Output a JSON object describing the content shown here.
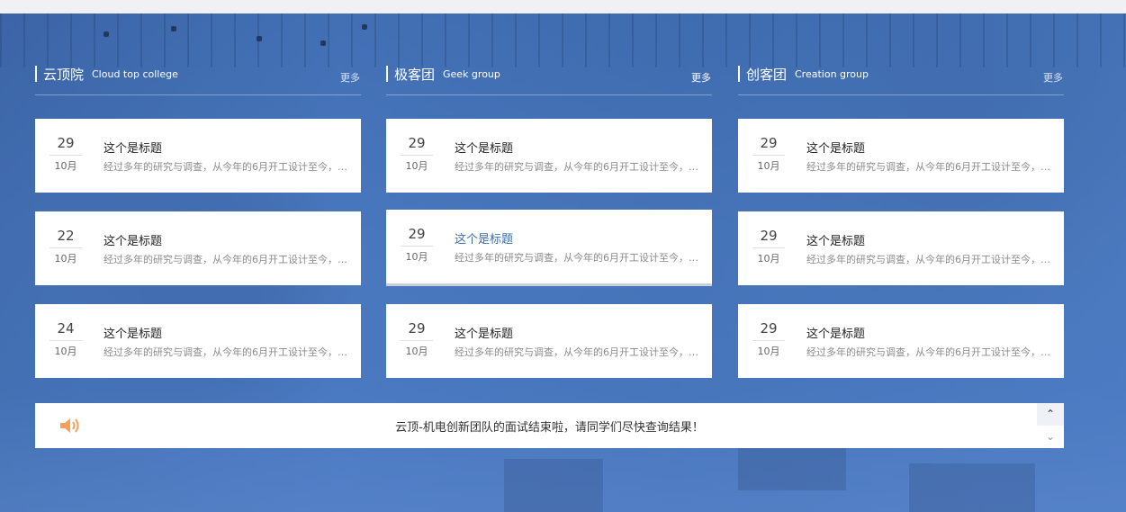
{
  "columns": [
    {
      "title_cn": "云顶院",
      "title_en": "Cloud top college",
      "more": "更多",
      "cards": [
        {
          "day": "29",
          "month": "10月",
          "title": "这个是标题",
          "desc": "经过多年的研究与调查，从今年的6月开工设计至今，已经三月有余"
        },
        {
          "day": "22",
          "month": "10月",
          "title": "这个是标题",
          "desc": "经过多年的研究与调查，从今年的6月开工设计至今，已经三月有余"
        },
        {
          "day": "24",
          "month": "10月",
          "title": "这个是标题",
          "desc": "经过多年的研究与调查，从今年的6月开工设计至今，已经三月有余"
        }
      ]
    },
    {
      "title_cn": "极客团",
      "title_en": "Geek group",
      "more": "更多",
      "cards": [
        {
          "day": "29",
          "month": "10月",
          "title": "这个是标题",
          "desc": "经过多年的研究与调查，从今年的6月开工设计至今，已经三月有余"
        },
        {
          "day": "29",
          "month": "10月",
          "title": "这个是标题",
          "desc": "经过多年的研究与调查，从今年的6月开工设计至今，已经三月有余"
        },
        {
          "day": "29",
          "month": "10月",
          "title": "这个是标题",
          "desc": "经过多年的研究与调查，从今年的6月开工设计至今，已经三月有余"
        }
      ]
    },
    {
      "title_cn": "创客团",
      "title_en": "Creation group",
      "more": "更多",
      "cards": [
        {
          "day": "29",
          "month": "10月",
          "title": "这个是标题",
          "desc": "经过多年的研究与调查，从今年的6月开工设计至今，已经三月有余"
        },
        {
          "day": "29",
          "month": "10月",
          "title": "这个是标题",
          "desc": "经过多年的研究与调查，从今年的6月开工设计至今，已经三月有余"
        },
        {
          "day": "29",
          "month": "10月",
          "title": "这个是标题",
          "desc": "经过多年的研究与调查，从今年的6月开工设计至今，已经三月有余"
        }
      ]
    }
  ],
  "notice": {
    "text": "云顶-机电创新团队的面试结束啦，请同学们尽快查询结果！",
    "icon": "speaker-icon",
    "up_arrow": "⌃",
    "down_arrow": "⌄"
  },
  "colors": {
    "background_blue": "#4a7ac4",
    "title_active": "#3a6ea8",
    "speaker": "#f5a05a"
  }
}
